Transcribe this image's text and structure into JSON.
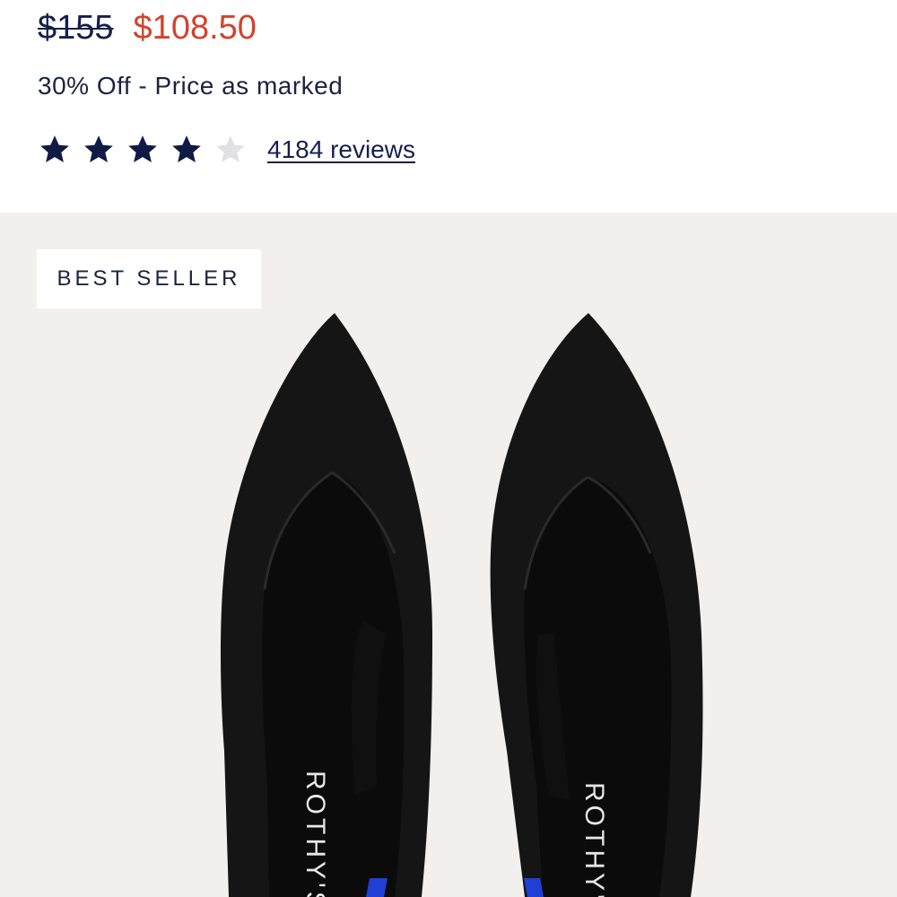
{
  "price": {
    "original": "$155",
    "sale": "$108.50"
  },
  "discount_note": "30% Off - Price as marked",
  "rating": {
    "value": 4,
    "max": 5,
    "reviews_label": "4184 reviews"
  },
  "product_image": {
    "badge": "BEST SELLER",
    "insole_brand": "ROTHY'S",
    "colors": {
      "background": "#f1f0ee",
      "shoe": "#151515",
      "accent_stripe": "#1f3fd6"
    }
  },
  "colors": {
    "sale_price": "#d1432e",
    "text": "#1b2340",
    "star_filled": "#0f1b45",
    "star_empty": "#e1e1e4"
  }
}
